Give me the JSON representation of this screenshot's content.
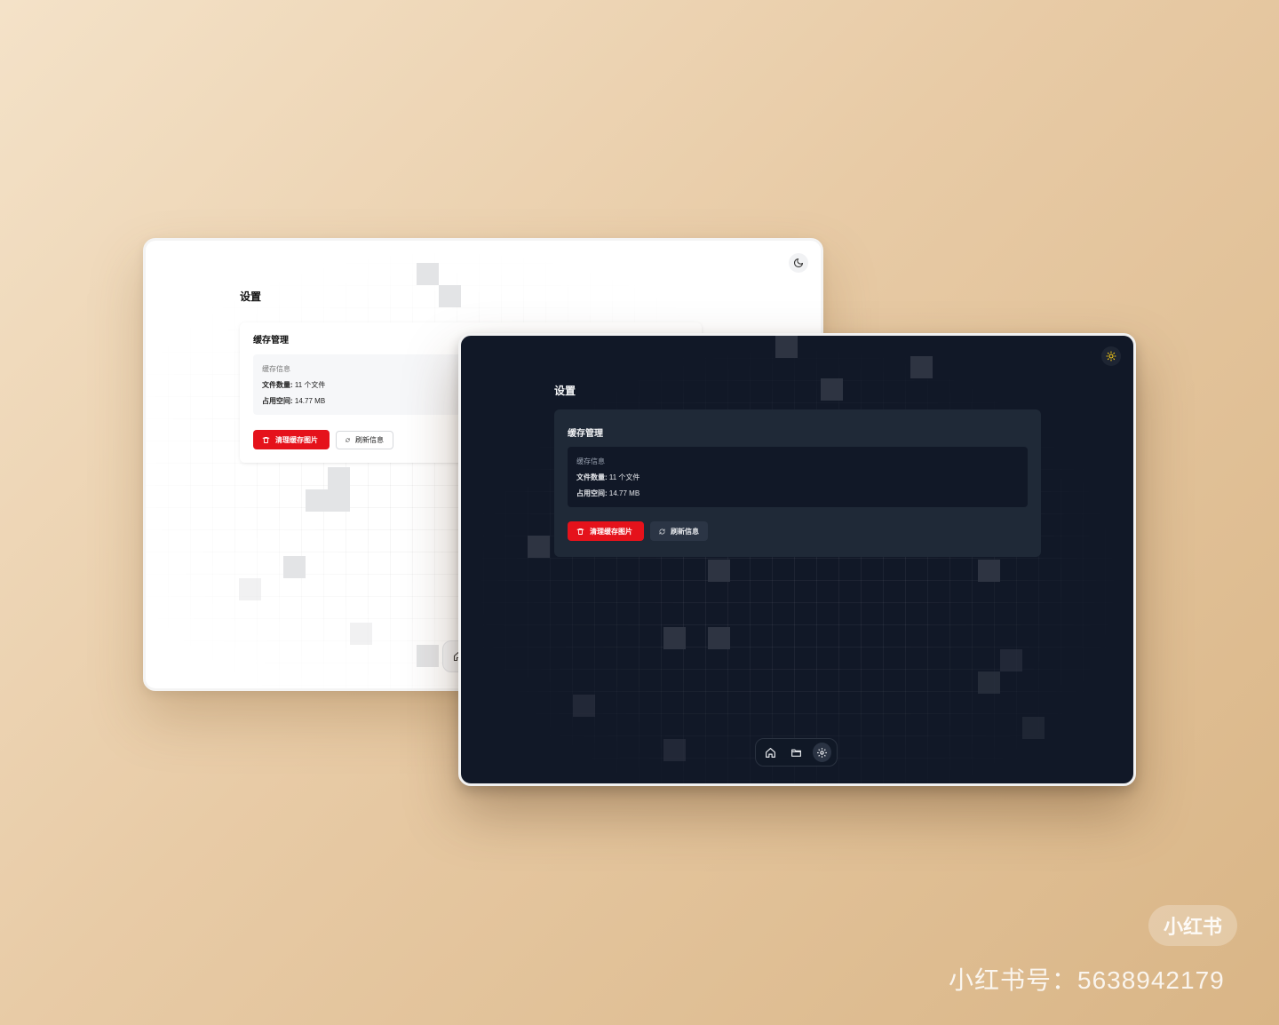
{
  "light": {
    "page_title": "设置",
    "card_title": "缓存管理",
    "info_label": "缓存信息",
    "files_label": "文件数量:",
    "files_value": "11 个文件",
    "space_label": "占用空间:",
    "space_value": "14.77 MB",
    "clear_button": "清理缓存图片",
    "refresh_button": "刷新信息",
    "theme_icon": "moon-icon"
  },
  "dark": {
    "page_title": "设置",
    "card_title": "缓存管理",
    "info_label": "缓存信息",
    "files_label": "文件数量:",
    "files_value": "11 个文件",
    "space_label": "占用空间:",
    "space_value": "14.77 MB",
    "clear_button": "清理缓存图片",
    "refresh_button": "刷新信息",
    "theme_icon": "sun-icon",
    "dock": [
      "home-icon",
      "folder-icon",
      "gear-icon"
    ]
  },
  "watermark": {
    "badge": "小红书",
    "id_text": "小红书号：5638942179"
  },
  "colors": {
    "danger": "#e5121b",
    "dark_bg": "#111827",
    "dark_card": "#1f2937",
    "sun_accent": "#facc15"
  }
}
